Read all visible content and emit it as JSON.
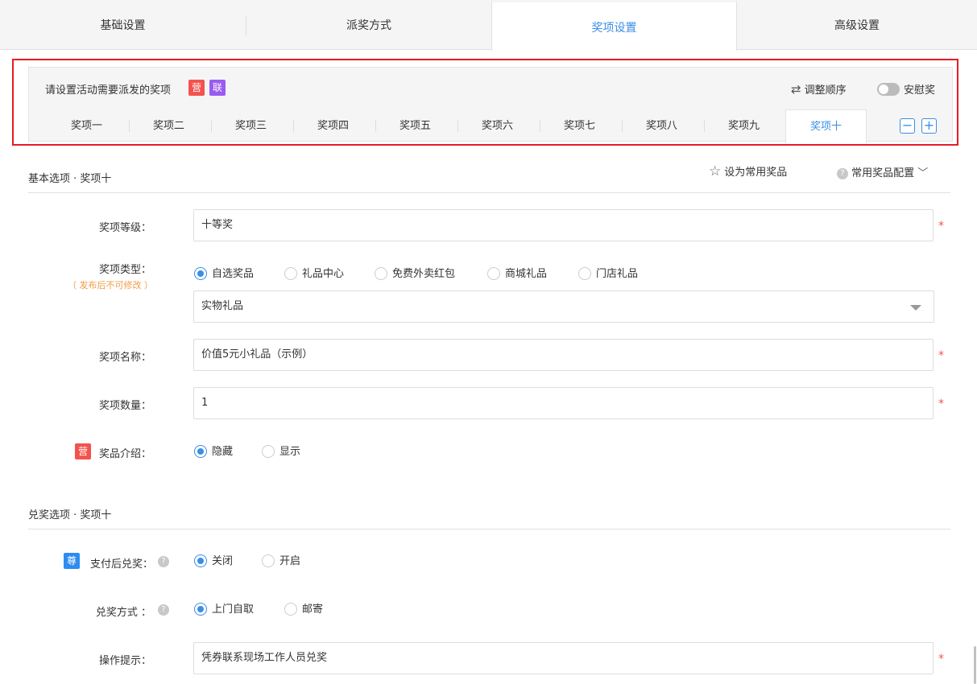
{
  "top_tabs": [
    "基础设置",
    "派奖方式",
    "奖项设置",
    "高级设置"
  ],
  "top_tab_active": "奖项设置",
  "prize_box": {
    "title": "请设置活动需要派发的奖项",
    "badge_ying": "营",
    "badge_lian": "联",
    "reorder_label": "调整顺序",
    "reorder_icon": "swap-icon",
    "consolation_label": "安慰奖",
    "consolation_on": false,
    "tabs": [
      "奖项一",
      "奖项二",
      "奖项三",
      "奖项四",
      "奖项五",
      "奖项六",
      "奖项七",
      "奖项八",
      "奖项九",
      "奖项十"
    ],
    "active_tab": "奖项十",
    "minus": "−",
    "plus": "+"
  },
  "basic": {
    "title": "基本选项 · 奖项十",
    "set_common": "设为常用奖品",
    "common_config": "常用奖品配置",
    "level_label": "奖项等级：",
    "level_value": "十等奖",
    "type_label": "奖项类型：",
    "type_note": "（ 发布后不可修改 ）",
    "type_options": [
      "自选奖品",
      "礼品中心",
      "免费外卖红包",
      "商城礼品",
      "门店礼品"
    ],
    "type_selected": "自选奖品",
    "type_select_value": "实物礼品",
    "name_label": "奖项名称：",
    "name_value": "价值5元小礼品（示例）",
    "qty_label": "奖项数量：",
    "qty_value": "1",
    "intro_badge": "营",
    "intro_label": "奖品介绍：",
    "intro_options": [
      "隐藏",
      "显示"
    ],
    "intro_selected": "隐藏",
    "required_mark": "*"
  },
  "redeem": {
    "title": "兑奖选项 · 奖项十",
    "pay_badge": "尊",
    "pay_label": "支付后兑奖：",
    "pay_options": [
      "关闭",
      "开启"
    ],
    "pay_selected": "关闭",
    "method_label": "兑奖方式 ：",
    "method_options": [
      "上门自取",
      "邮寄"
    ],
    "method_selected": "上门自取",
    "tip_label": "操作提示：",
    "tip_value": "凭券联系现场工作人员兑奖",
    "required_mark": "*"
  },
  "colors": {
    "accent": "#3a8ee6",
    "required": "#f4524d",
    "note": "#f39c46",
    "frame": "#e51c23"
  }
}
